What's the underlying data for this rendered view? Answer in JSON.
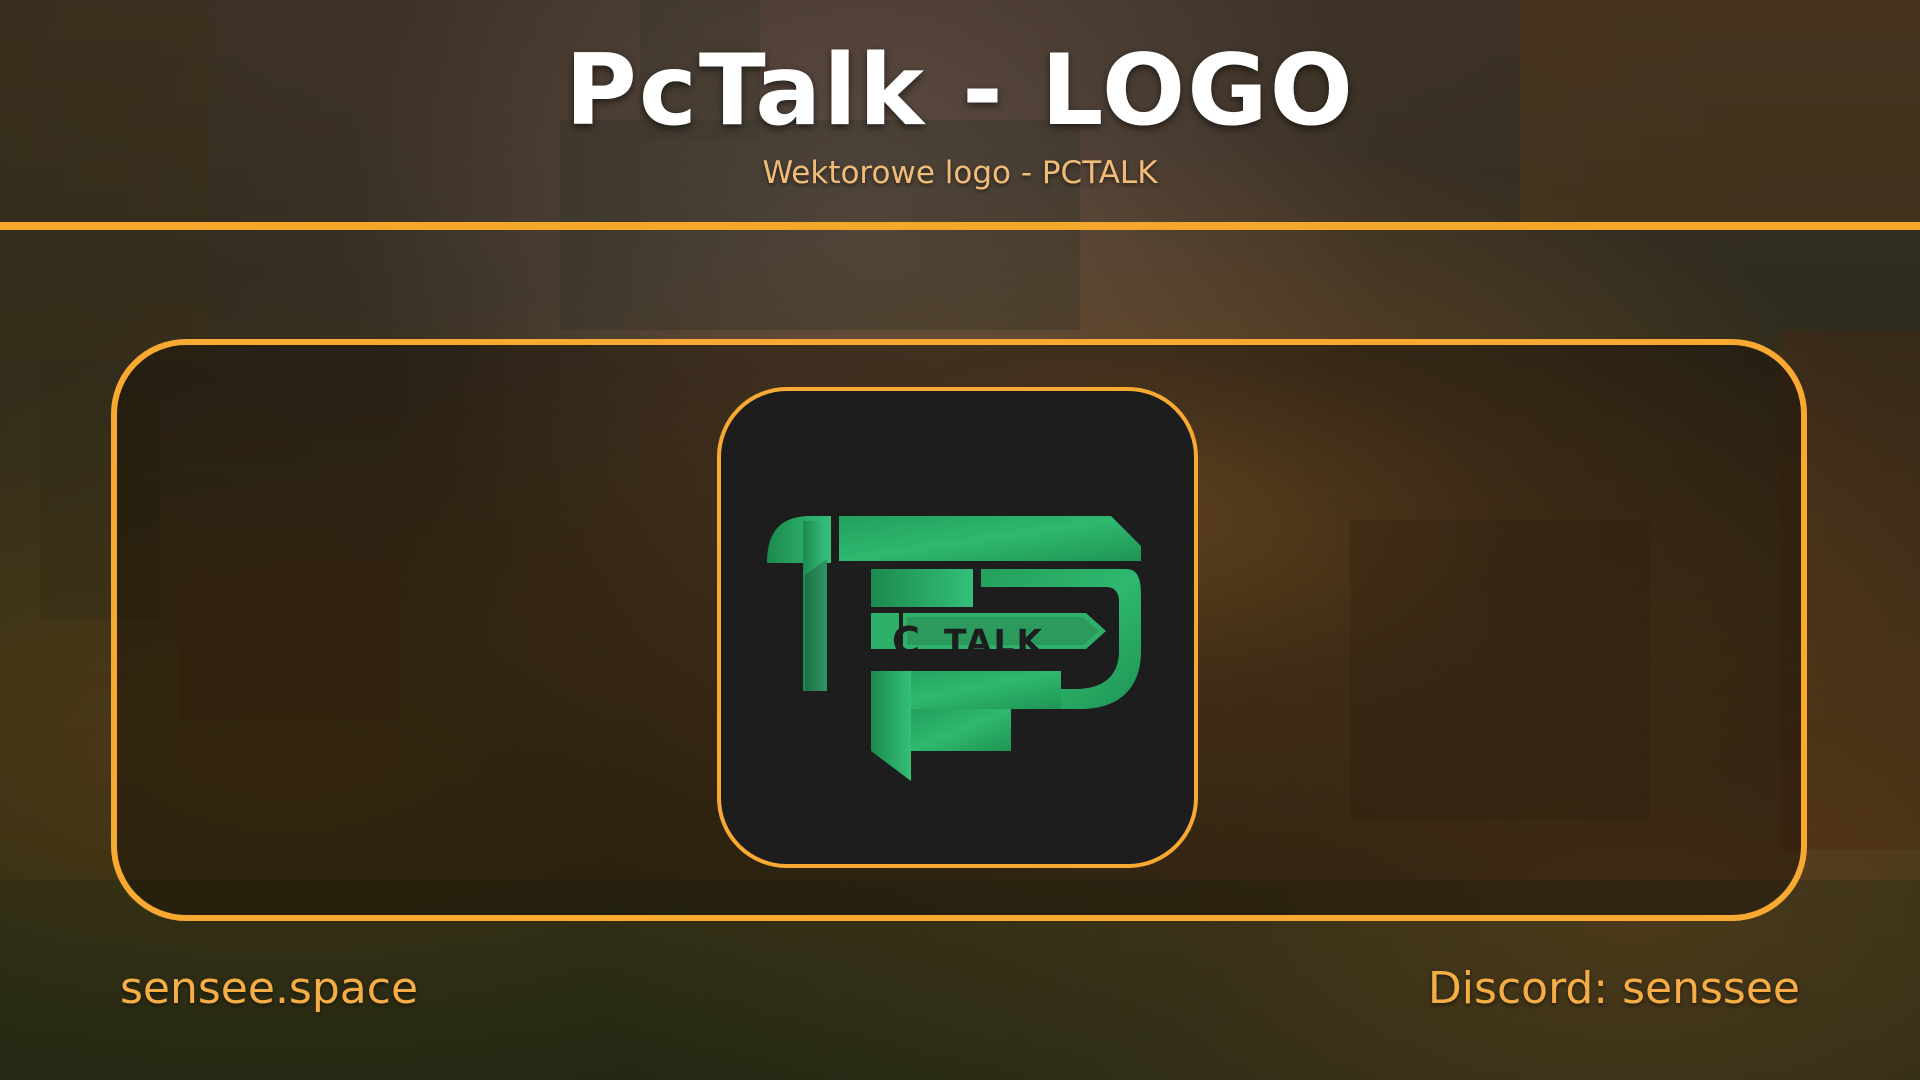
{
  "header": {
    "title": "PcTalk - LOGO",
    "subtitle": "Wektorowe logo - PCTALK"
  },
  "logo": {
    "letters": [
      "C",
      "TALK"
    ]
  },
  "footer": {
    "website": "sensee.space",
    "discord": "Discord: senssee"
  },
  "colors": {
    "accent": "#f5a72a",
    "logo_green": "#2fb069",
    "logo_tile": "#1d1d1d"
  }
}
